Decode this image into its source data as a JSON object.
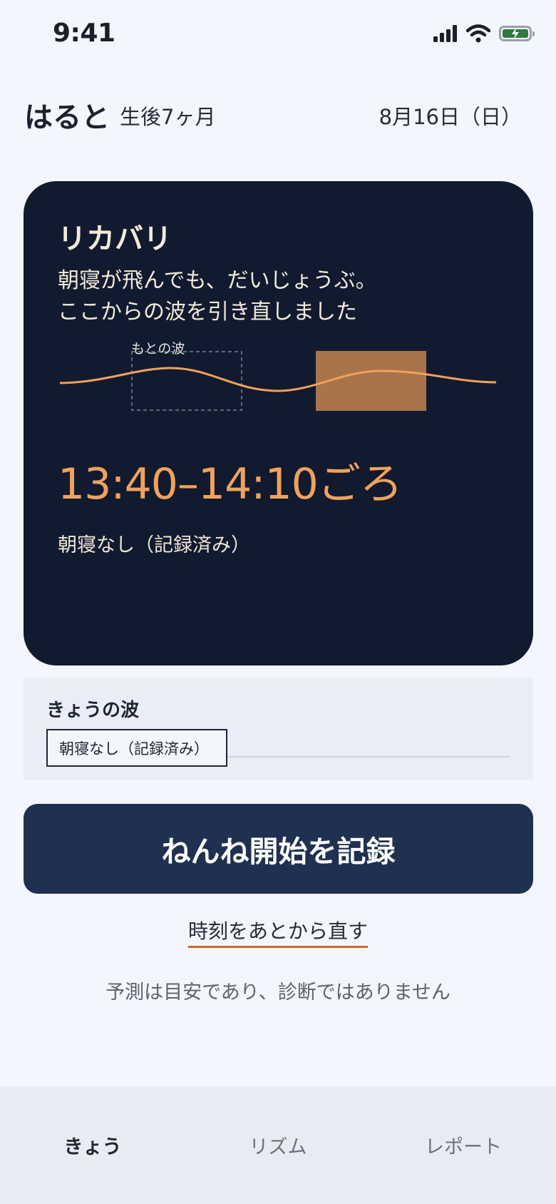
{
  "status_bar": {
    "time": "9:41",
    "icons": [
      "signal-icon",
      "wifi-icon",
      "battery-charging-icon"
    ],
    "battery_color": "#2f7a3e"
  },
  "header": {
    "child_name": "はると",
    "child_age": "生後7ヶ月",
    "date": "8月16日（日）"
  },
  "card": {
    "title": "リカバリ",
    "message_line1": "朝寝が飛んでも、だいじょうぶ。",
    "message_line2": "ここからの波を引き直しました",
    "original_wave_label": "もとの波",
    "predicted_window": "13:40–14:10ごろ",
    "status": "朝寝なし（記録済み）",
    "colors": {
      "background": "#121a2f",
      "accent": "#f0a25c",
      "highlight": "#a8754b"
    }
  },
  "wave_panel": {
    "title": "きょうの波",
    "entry_label": "朝寝なし（記録済み）"
  },
  "actions": {
    "primary_label": "ねんね開始を記録",
    "fix_time_label": "時刻をあとから直す"
  },
  "disclaimer": "予測は目安であり、診断ではありません",
  "tabs": [
    {
      "label": "きょう",
      "active": true
    },
    {
      "label": "リズム",
      "active": false
    },
    {
      "label": "レポート",
      "active": false
    }
  ]
}
